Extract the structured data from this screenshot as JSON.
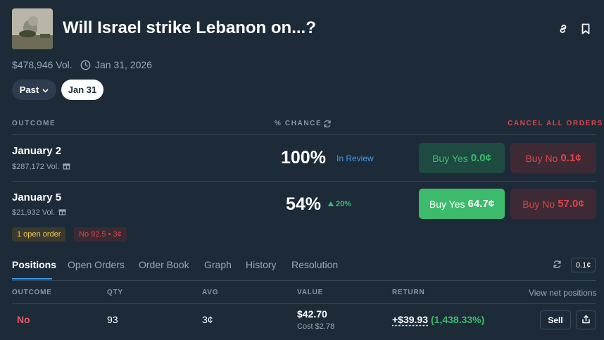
{
  "header": {
    "title": "Will Israel strike Lebanon on...?",
    "volume": "$478,946 Vol.",
    "end_date": "Jan 31, 2026",
    "icons": [
      "link-icon",
      "bookmark-icon",
      "clock-icon"
    ]
  },
  "date_filter": {
    "past_label": "Past",
    "selected_date": "Jan 31"
  },
  "outcomes_header": {
    "outcome": "OUTCOME",
    "chance": "% CHANCE",
    "cancel_all": "CANCEL ALL ORDERS"
  },
  "outcomes": [
    {
      "name": "January 2",
      "volume": "$287,172 Vol.",
      "chance": "100%",
      "status": "In Review",
      "buy_yes_label": "Buy Yes",
      "buy_yes_price": "0.0¢",
      "buy_no_label": "Buy No",
      "buy_no_price": "0.1¢"
    },
    {
      "name": "January 5",
      "volume": "$21,932 Vol.",
      "chance": "54%",
      "change": "20%",
      "buy_yes_label": "Buy Yes",
      "buy_yes_price": "64.7¢",
      "buy_no_label": "Buy No",
      "buy_no_price": "57.0¢",
      "open_order_badge": "1 open order",
      "order_badge": "No 92.5 • 3¢"
    }
  ],
  "tabs": [
    "Positions",
    "Open Orders",
    "Order Book",
    "Graph",
    "History",
    "Resolution"
  ],
  "active_tab": "Positions",
  "tick_size": "0.1¢",
  "positions": {
    "headers": {
      "outcome": "OUTCOME",
      "qty": "QTY",
      "avg": "AVG",
      "value": "VALUE",
      "return": "RETURN"
    },
    "view_net": "View net positions",
    "rows": [
      {
        "outcome": "No",
        "qty": "93",
        "avg": "3¢",
        "value": "$42.70",
        "cost": "Cost $2.78",
        "return": "+$39.93",
        "return_pct": "(1,438.33%)",
        "sell_label": "Sell"
      }
    ]
  },
  "colors": {
    "background": "#1d2b39",
    "green": "#3dbb6c",
    "red": "#d9464a",
    "blue_link": "#3f9bea",
    "yellow": "#f2c94c"
  }
}
